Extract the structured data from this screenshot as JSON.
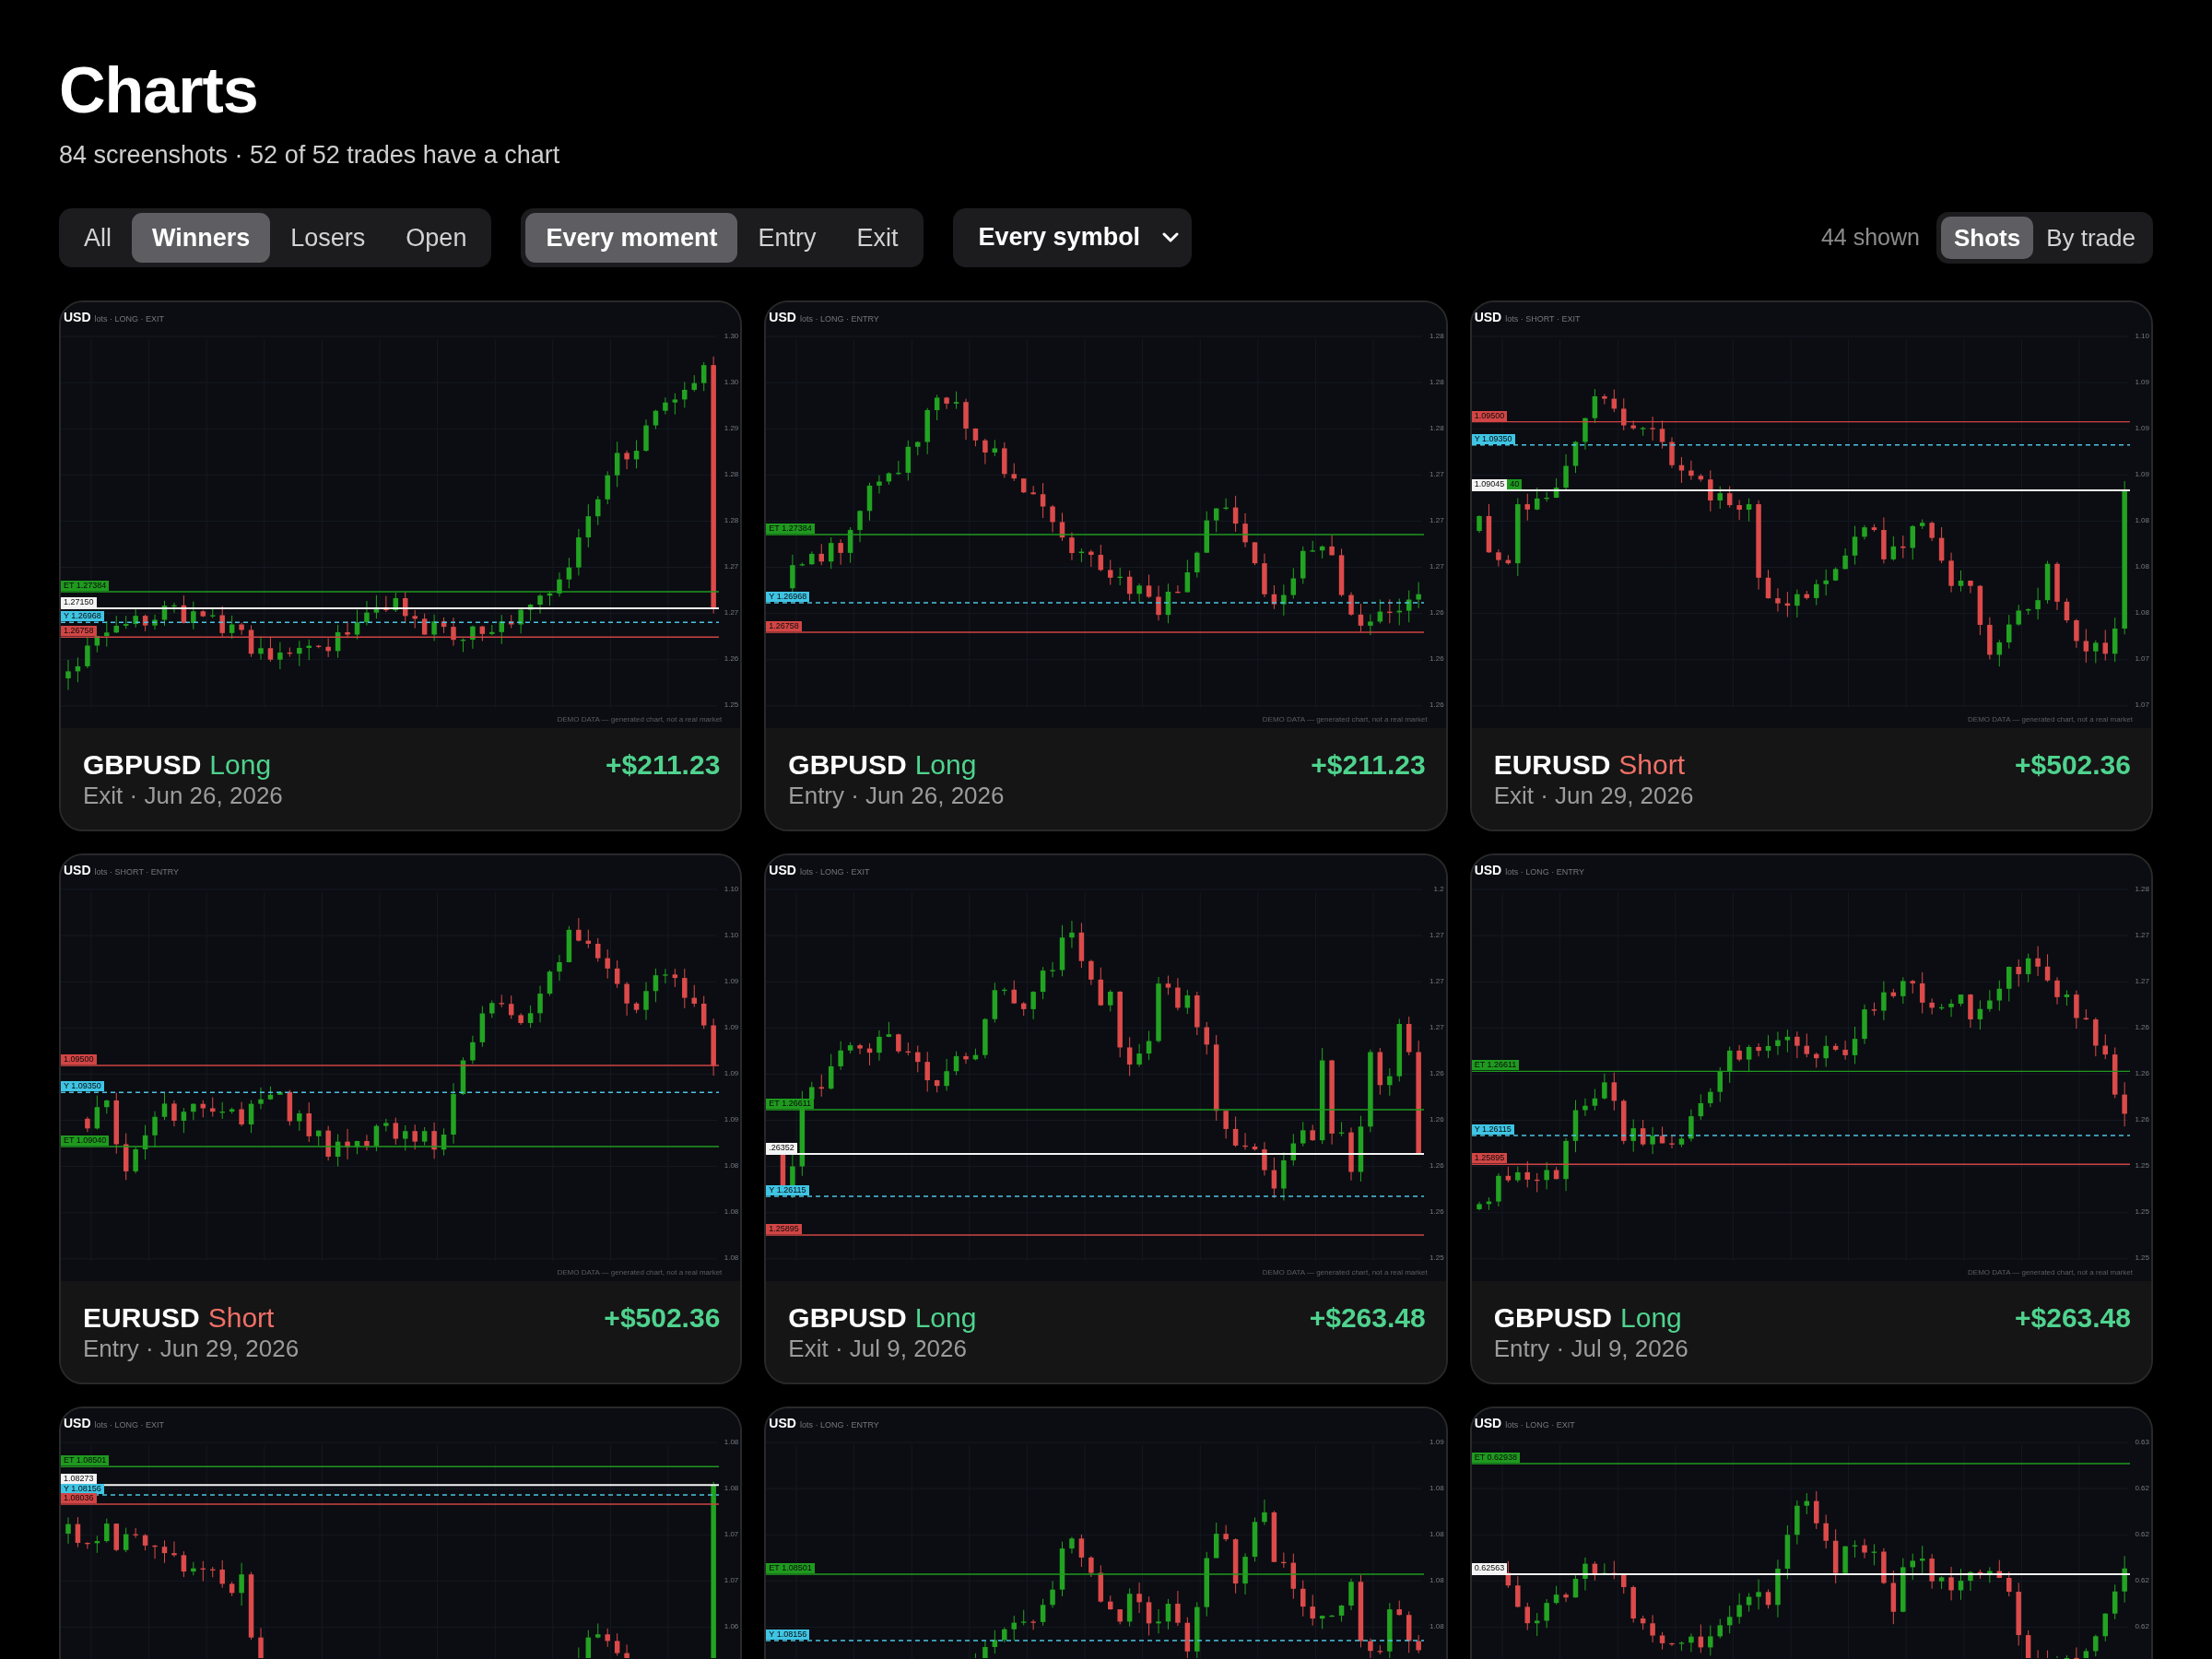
{
  "header": {
    "title": "Charts",
    "subtitle": "84 screenshots · 52 of 52 trades have a chart"
  },
  "filters": {
    "outcome": [
      {
        "label": "All",
        "selected": false
      },
      {
        "label": "Winners",
        "selected": true
      },
      {
        "label": "Losers",
        "selected": false
      },
      {
        "label": "Open",
        "selected": false
      }
    ],
    "moment": [
      {
        "label": "Every moment",
        "selected": true
      },
      {
        "label": "Entry",
        "selected": false
      },
      {
        "label": "Exit",
        "selected": false
      }
    ],
    "symbol_select": {
      "value": "Every symbol"
    },
    "count": "44 shown",
    "view": [
      {
        "label": "Shots",
        "selected": true
      },
      {
        "label": "By trade",
        "selected": false
      }
    ]
  },
  "cards": [
    {
      "chart": {
        "symbol": "USD",
        "meta": "lots · LONG · EXIT",
        "price_tags": [
          {
            "kind": "target",
            "text": "ET 1.27384"
          },
          {
            "kind": "exit",
            "text": "1.27150"
          },
          {
            "kind": "entry",
            "text": "Y 1.26968"
          },
          {
            "kind": "stop",
            "text": "1.26758"
          }
        ],
        "axis_ticks": [
          "1.30",
          "1.30",
          "1.29",
          "1.28",
          "1.28",
          "1.27",
          "1.27",
          "1.26",
          "1.25"
        ],
        "note": "DEMO DATA — generated chart, not a real market"
      },
      "footer": {
        "symbol": "GBPUSD",
        "side": {
          "text": "Long",
          "kind": "long"
        },
        "moment": "Exit · Jun 26, 2026",
        "pnl": "+$211.23"
      }
    },
    {
      "chart": {
        "symbol": "USD",
        "meta": "lots · LONG · ENTRY",
        "price_tags": [
          {
            "kind": "target",
            "text": "ET 1.27384"
          },
          {
            "kind": "entry",
            "text": "Y 1.26968"
          },
          {
            "kind": "stop",
            "text": "1.26758"
          }
        ],
        "axis_ticks": [
          "1.28",
          "1.28",
          "1.28",
          "1.27",
          "1.27",
          "1.27",
          "1.26",
          "1.26",
          "1.26"
        ],
        "note": "DEMO DATA — generated chart, not a real market"
      },
      "footer": {
        "symbol": "GBPUSD",
        "side": {
          "text": "Long",
          "kind": "long"
        },
        "moment": "Entry · Jun 26, 2026",
        "pnl": "+$211.23"
      }
    },
    {
      "chart": {
        "symbol": "USD",
        "meta": "lots · SHORT · EXIT",
        "price_tags": [
          {
            "kind": "stop",
            "text": "1.09500"
          },
          {
            "kind": "entry",
            "text": "Y 1.09350"
          },
          {
            "kind": "exit",
            "text": "1.09045"
          },
          {
            "kind": "target",
            "text": "40"
          }
        ],
        "axis_ticks": [
          "1.10",
          "1.09",
          "1.09",
          "1.09",
          "1.08",
          "1.08",
          "1.08",
          "1.07",
          "1.07"
        ],
        "note": "DEMO DATA — generated chart, not a real market"
      },
      "footer": {
        "symbol": "EURUSD",
        "side": {
          "text": "Short",
          "kind": "short"
        },
        "moment": "Exit · Jun 29, 2026",
        "pnl": "+$502.36"
      }
    },
    {
      "chart": {
        "symbol": "USD",
        "meta": "lots · SHORT · ENTRY",
        "price_tags": [
          {
            "kind": "stop",
            "text": "1.09500"
          },
          {
            "kind": "entry",
            "text": "Y 1.09350"
          },
          {
            "kind": "target",
            "text": "ET 1.09040"
          }
        ],
        "axis_ticks": [
          "1.10",
          "1.10",
          "1.09",
          "1.09",
          "1.09",
          "1.09",
          "1.08",
          "1.08",
          "1.08"
        ],
        "note": "DEMO DATA — generated chart, not a real market"
      },
      "footer": {
        "symbol": "EURUSD",
        "side": {
          "text": "Short",
          "kind": "short"
        },
        "moment": "Entry · Jun 29, 2026",
        "pnl": "+$502.36"
      }
    },
    {
      "chart": {
        "symbol": "USD",
        "meta": "lots · LONG · EXIT",
        "price_tags": [
          {
            "kind": "target",
            "text": "ET 1.26611"
          },
          {
            "kind": "exit",
            "text": ".26352"
          },
          {
            "kind": "entry",
            "text": "Y 1.26115"
          },
          {
            "kind": "stop",
            "text": "1.25895"
          }
        ],
        "axis_ticks": [
          "1.2",
          "1.27",
          "1.27",
          "1.27",
          "1.26",
          "1.26",
          "1.26",
          "1.26",
          "1.25"
        ],
        "note": "DEMO DATA — generated chart, not a real market"
      },
      "footer": {
        "symbol": "GBPUSD",
        "side": {
          "text": "Long",
          "kind": "long"
        },
        "moment": "Exit · Jul 9, 2026",
        "pnl": "+$263.48"
      }
    },
    {
      "chart": {
        "symbol": "USD",
        "meta": "lots · LONG · ENTRY",
        "price_tags": [
          {
            "kind": "target",
            "text": "ET 1.26611"
          },
          {
            "kind": "entry",
            "text": "Y 1.26115"
          },
          {
            "kind": "stop",
            "text": "1.25895"
          }
        ],
        "axis_ticks": [
          "1.28",
          "1.27",
          "1.27",
          "1.26",
          "1.26",
          "1.26",
          "1.25",
          "1.25",
          "1.25"
        ],
        "note": "DEMO DATA — generated chart, not a real market"
      },
      "footer": {
        "symbol": "GBPUSD",
        "side": {
          "text": "Long",
          "kind": "long"
        },
        "moment": "Entry · Jul 9, 2026",
        "pnl": "+$263.48"
      }
    },
    {
      "chart": {
        "symbol": "USD",
        "meta": "lots · LONG · EXIT",
        "price_tags": [
          {
            "kind": "target",
            "text": "ET 1.08501"
          },
          {
            "kind": "exit",
            "text": "1.08273"
          },
          {
            "kind": "entry",
            "text": "Y 1.08156"
          },
          {
            "kind": "stop",
            "text": "1.08036"
          }
        ],
        "axis_ticks": [
          "1.08",
          "1.08",
          "1.07",
          "1.07",
          "1.06"
        ]
      }
    },
    {
      "chart": {
        "symbol": "USD",
        "meta": "lots · LONG · ENTRY",
        "price_tags": [
          {
            "kind": "target",
            "text": "ET 1.08501"
          },
          {
            "kind": "entry",
            "text": "Y 1.08156"
          }
        ],
        "axis_ticks": [
          "1.09",
          "1.08",
          "1.08",
          "1.08",
          "1.08"
        ]
      }
    },
    {
      "chart": {
        "symbol": "USD",
        "meta": "lots · LONG · EXIT",
        "price_tags": [
          {
            "kind": "target",
            "text": "ET 0.62938"
          },
          {
            "kind": "exit",
            "text": "0.62563"
          }
        ],
        "axis_ticks": [
          "0.63",
          "0.62",
          "0.62",
          "0.62",
          "0.62"
        ]
      }
    }
  ]
}
